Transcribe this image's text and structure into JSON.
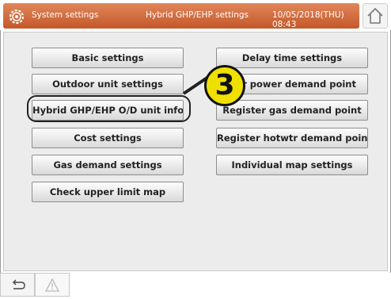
{
  "header": {
    "title": "System settings",
    "subtitle": "Hybrid GHP/EHP settings",
    "datetime": "10/05/2018(THU) 08:43",
    "icon": "gear-icon",
    "home_icon": "home-icon",
    "accent_color": "#d56b3c"
  },
  "buttons": {
    "left": [
      "Basic settings",
      "Outdoor unit settings",
      "Hybrid GHP/EHP O/D unit info",
      "Cost settings",
      "Gas demand settings",
      "Check upper limit map"
    ],
    "right": [
      "Delay time settings",
      "ter power demand point",
      "Register gas demand point",
      "Register hotwtr demand point",
      "Individual map settings"
    ]
  },
  "callout": {
    "number": "3",
    "color": "#f0e000"
  },
  "footer": {
    "back_icon": "back-icon",
    "warning_icon": "warning-icon"
  }
}
